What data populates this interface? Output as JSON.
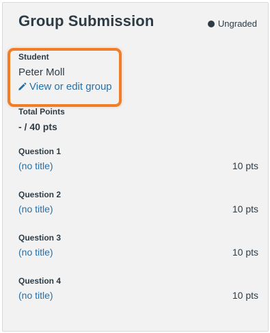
{
  "header": {
    "title": "Group Submission",
    "status": "Ungraded"
  },
  "student": {
    "label": "Student",
    "name": "Peter Moll",
    "edit_link": "View or edit group"
  },
  "total_points": {
    "label": "Total Points",
    "value": "- / 40 pts"
  },
  "questions": [
    {
      "label": "Question 1",
      "title": "(no title)",
      "points": "10 pts"
    },
    {
      "label": "Question 2",
      "title": "(no title)",
      "points": "10 pts"
    },
    {
      "label": "Question 3",
      "title": "(no title)",
      "points": "10 pts"
    },
    {
      "label": "Question 4",
      "title": "(no title)",
      "points": "10 pts"
    }
  ],
  "colors": {
    "link": "#2570a8",
    "text": "#2d3b45",
    "highlight": "#f07d28",
    "panel_bg": "#f2f2f3"
  },
  "icons": {
    "status": "filled-circle-icon",
    "edit": "pencil-icon"
  }
}
